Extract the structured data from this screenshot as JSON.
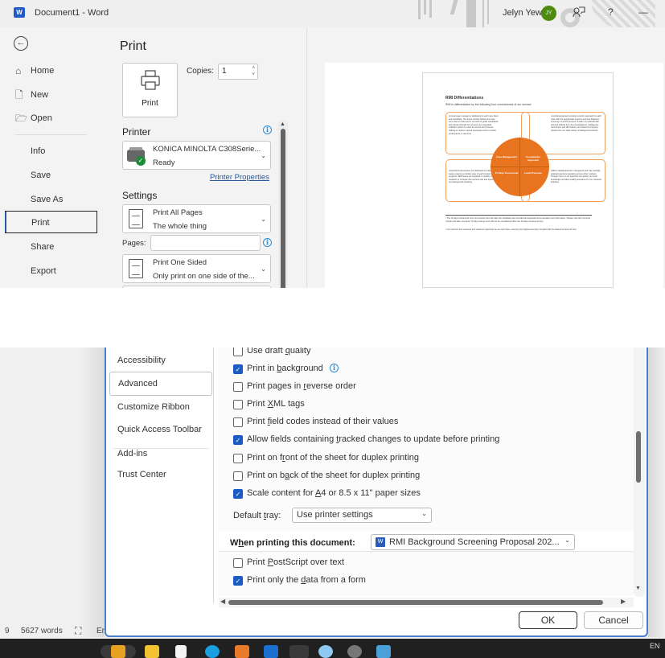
{
  "window": {
    "app_title": "Document1  -  Word",
    "word_logo": "W",
    "user_name": "Jelyn Yew",
    "user_initials": "JY",
    "icons": [
      "presenter-coach-icon",
      "help-icon",
      "minimize-icon"
    ],
    "help_label": "?",
    "minimize_label": "—"
  },
  "backstage_nav": {
    "back_icon": "←",
    "items": [
      {
        "label": "Home",
        "icon": "⌂"
      },
      {
        "label": "New",
        "icon": "🗋"
      },
      {
        "label": "Open",
        "icon": "🗁"
      },
      {
        "label": "Info"
      },
      {
        "label": "Save"
      },
      {
        "label": "Save As"
      },
      {
        "label": "Print",
        "selected": true
      },
      {
        "label": "Share"
      },
      {
        "label": "Export"
      }
    ]
  },
  "print_panel": {
    "heading": "Print",
    "print_button_label": "Print",
    "copies_label": "Copies:",
    "copies_value": "1",
    "printer_section": "Printer",
    "printer_name": "KONICA MINOLTA C308Serie...",
    "printer_status": "Ready",
    "printer_properties_link": "Printer Properties",
    "settings_section": "Settings",
    "pages_setting": {
      "title": "Print All Pages",
      "subtitle": "The whole thing"
    },
    "pages_label": "Pages:",
    "pages_value": "",
    "sides_setting": {
      "title": "Print One Sided",
      "subtitle": "Only print on one side of the..."
    },
    "info_glyph": "i",
    "chevron": "⌄"
  },
  "preview": {
    "page_title": "RMI Differentiations",
    "page_intro": "RMI is differentiated by the following four cornerstones of our service:",
    "quadrants": [
      "•A local case manager is dedicated to each new client and candidate. The same contact follows the case from start to finish and is on hand to guide candidates and clients through the process •An integrated software system to track the end-to-end process, helping to reduce manual processes and to monitor performance in real time",
      "•A professional and employer-centric approach to each case with the appropriate urgency and due diligence, ensuring a smooth process •A team of professionals sourced directly from the investigations, intelligence, recruitment and HR industry are trained to interpret results from our wide variety of background checks",
      "•Operations Executives are dedicated to individual cases ensuring a holistic view of each project and progress •RMI teams are targeted on quality of research to increase the success rate and speed of our background checking",
      "•RMI is headquartered in Singapore and has carefully selected partners operating across other markets. Though many of our searches are global, our local knowledge provides quality assurance for our research activities"
    ],
    "circle_labels": [
      "Case Management",
      "Consultative Approach",
      "15 Days Turnaround",
      "Local Presence"
    ],
    "footnotes": [
      "¹ The 15 days turnaround time commences from the date the candidate has provided all requested documentation and information. Please note that Criminal Checks will take more than 15 days and as such will not be considered within the 15 days turnaround time.",
      "² Our partners are screened and vetted as rigorously as our own hires, ensuring the highest accuracy coupled with the fastest turnaround time."
    ]
  },
  "options_dialog": {
    "nav_items": [
      {
        "label": "Accessibility"
      },
      {
        "label": "Advanced",
        "selected": true
      },
      {
        "label": "Customize Ribbon"
      },
      {
        "label": "Quick Access Toolbar"
      },
      {
        "label": "Add-ins"
      },
      {
        "label": "Trust Center"
      }
    ],
    "print_options": [
      {
        "pre": "Use draft ",
        "u": "q",
        "post": "uality",
        "checked": false
      },
      {
        "pre": "Print in ",
        "u": "b",
        "post": "ackground",
        "checked": true,
        "info": true
      },
      {
        "pre": "Print pages in ",
        "u": "r",
        "post": "everse order",
        "checked": false
      },
      {
        "pre": "Print ",
        "u": "X",
        "post": "ML tags",
        "checked": false
      },
      {
        "pre": "Print ",
        "u": "f",
        "post": "ield codes instead of their values",
        "checked": false
      },
      {
        "pre": "Allow fields containing ",
        "u": "t",
        "post": "racked changes to update before printing",
        "checked": true
      },
      {
        "pre": "Print on f",
        "u": "r",
        "post": "ont of the sheet for duplex printing",
        "checked": false
      },
      {
        "pre": "Print on b",
        "u": "a",
        "post": "ck of the sheet for duplex printing",
        "checked": false
      },
      {
        "pre": "Scale content for ",
        "u": "A",
        "post": "4 or 8.5 x 11\" paper sizes",
        "checked": true
      }
    ],
    "default_tray_label_pre": "Default ",
    "default_tray_label_u": "t",
    "default_tray_label_post": "ray:",
    "default_tray_value": "Use printer settings",
    "when_printing_pre": "W",
    "when_printing_u": "h",
    "when_printing_post": "en printing this document:",
    "document_select_value": "RMI Background Screening Proposal 202...",
    "doc_options": [
      {
        "pre": "Print ",
        "u": "P",
        "post": "ostScript over text",
        "checked": false
      },
      {
        "pre": "Print only the ",
        "u": "d",
        "post": "ata from a form",
        "checked": true
      }
    ],
    "ok_label": "OK",
    "cancel_label": "Cancel",
    "check_glyph": "✓"
  },
  "status_bar": {
    "page_fragment": "9",
    "word_count": "5627 words",
    "language_fragment": "Er"
  },
  "taskbar": {
    "lang": "EN",
    "apps": [
      "file-explorer",
      "sticky-app",
      "skype",
      "mail-app",
      "outlook",
      "word",
      "app",
      "settings",
      "app"
    ]
  },
  "colors": {
    "accent_blue": "#1a5cc4",
    "avatar_green": "#4f8a10",
    "diagram_orange": "#e8741f"
  }
}
